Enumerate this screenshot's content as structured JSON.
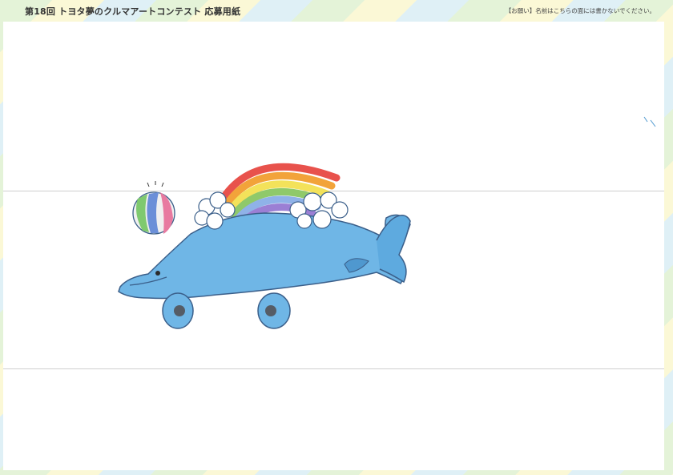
{
  "header": {
    "title": "第18回 トヨタ夢のクルマアートコンテスト 応募用紙",
    "notice": "【お願い】名前はこちらの面には書かないでください。"
  },
  "artwork": {
    "subject": "",
    "colors": {
      "body": "#6fb6e6",
      "outline": "#3b5f8a",
      "rainbow": [
        "#e8524c",
        "#f2a33a",
        "#f3e25a",
        "#8fc96a",
        "#8fb2e8",
        "#9b7fd4"
      ],
      "cloud": "#ffffff",
      "ball": [
        "#e87aa0",
        "#7fc96f",
        "#6b8fd8",
        "#f0f0f0"
      ]
    }
  }
}
